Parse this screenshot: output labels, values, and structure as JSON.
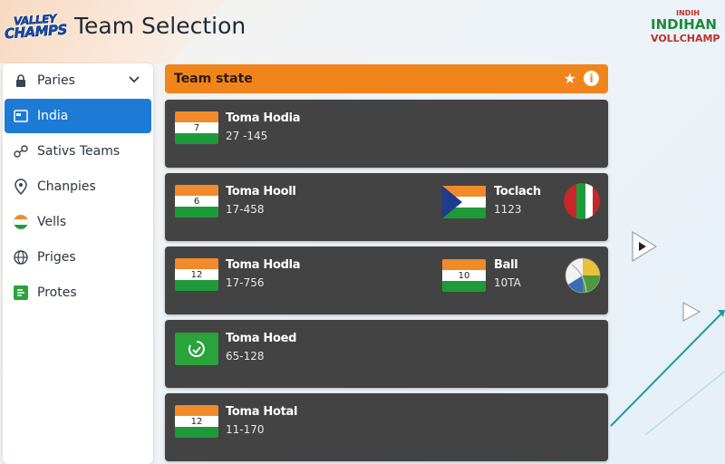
{
  "header": {
    "logo_line1": "VALLEY",
    "logo_line2": "CHAMPS",
    "title": "Team Selection",
    "brand_line1": "INDIH",
    "brand_line2": "INDIHAN",
    "brand_line3": "VOLLCHAMP"
  },
  "sidebar": {
    "items": [
      {
        "label": "Paries",
        "icon": "lock-icon"
      },
      {
        "label": "India",
        "icon": "flag-square-icon"
      },
      {
        "label": "Sativs Teams",
        "icon": "link-icon"
      },
      {
        "label": "Chanpies",
        "icon": "location-pin-icon"
      },
      {
        "label": "Vells",
        "icon": "india-flag-icon"
      },
      {
        "label": "Priges",
        "icon": "globe-icon"
      },
      {
        "label": "Protes",
        "icon": "green-badge-icon"
      }
    ],
    "active_index": 1
  },
  "panel": {
    "title": "Team state"
  },
  "rows": [
    {
      "left": {
        "flag_number": "7",
        "name": "Toma Hodia",
        "score": "27 -145"
      }
    },
    {
      "left": {
        "flag_number": "6",
        "name": "Toma Hooll",
        "score": "17-458"
      },
      "right": {
        "name": "Toclach",
        "score": "1123"
      }
    },
    {
      "left": {
        "flag_number": "12",
        "name": "Toma Hodla",
        "score": "17-756"
      },
      "right": {
        "flag_number": "10",
        "name": "Ball",
        "score": "10TA"
      }
    },
    {
      "left": {
        "name": "Toma Hoed",
        "score": "65-128"
      }
    },
    {
      "left": {
        "flag_number": "12",
        "name": "Toma Hotal",
        "score": "11-170"
      }
    }
  ],
  "colors": {
    "accent": "#f0851c",
    "active": "#1d7bd6",
    "row_bg": "#434343"
  }
}
